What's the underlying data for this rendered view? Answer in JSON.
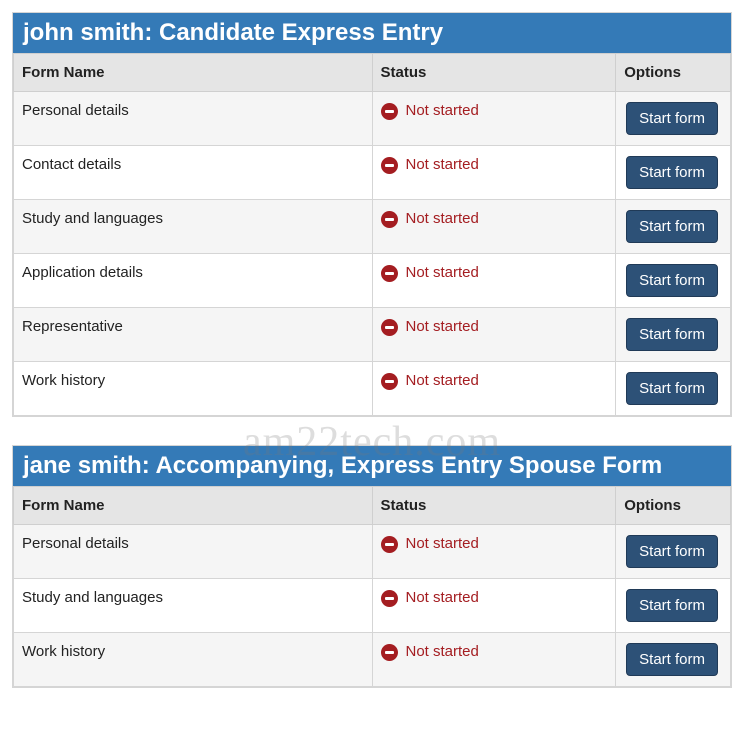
{
  "columns": {
    "form_name": "Form Name",
    "status": "Status",
    "options": "Options"
  },
  "buttons": {
    "start_form": "Start form"
  },
  "status_labels": {
    "not_started": "Not started"
  },
  "watermark": "am22tech.com",
  "panels": [
    {
      "title": "john smith: Candidate Express Entry",
      "rows": [
        {
          "name": "Personal details",
          "status": "not_started"
        },
        {
          "name": "Contact details",
          "status": "not_started"
        },
        {
          "name": "Study and languages",
          "status": "not_started"
        },
        {
          "name": "Application details",
          "status": "not_started"
        },
        {
          "name": "Representative",
          "status": "not_started"
        },
        {
          "name": "Work history",
          "status": "not_started"
        }
      ]
    },
    {
      "title": "jane smith: Accompanying, Express Entry Spouse Form",
      "rows": [
        {
          "name": "Personal details",
          "status": "not_started"
        },
        {
          "name": "Study and languages",
          "status": "not_started"
        },
        {
          "name": "Work history",
          "status": "not_started"
        }
      ]
    }
  ]
}
